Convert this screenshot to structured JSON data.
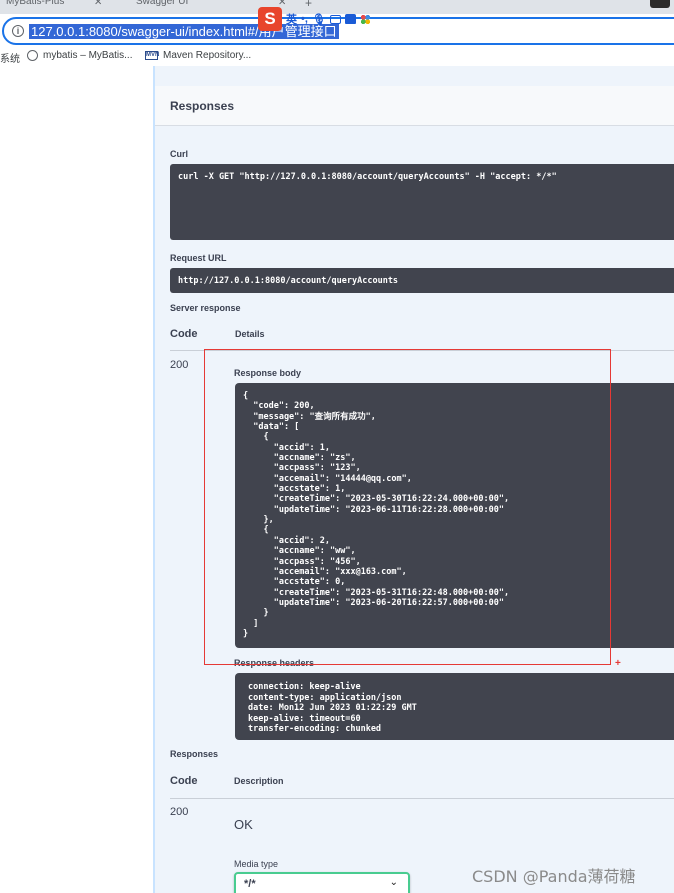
{
  "browser": {
    "tabs": [
      {
        "title": "MyBatis-Plus"
      },
      {
        "title": "Swagger UI"
      }
    ],
    "url": "127.0.0.1:8080/swagger-ui/index.html#/用户管理接口",
    "ime": {
      "label": "英"
    },
    "bookmarks": [
      {
        "label": "系统"
      },
      {
        "label": "mybatis – MyBatis..."
      },
      {
        "label": "Maven Repository..."
      }
    ]
  },
  "responses_section": {
    "title": "Responses",
    "curl_label": "Curl",
    "curl_command": "curl -X GET \"http://127.0.0.1:8080/account/queryAccounts\" -H \"accept: */*\"",
    "request_url_label": "Request URL",
    "request_url": "http://127.0.0.1:8080/account/queryAccounts",
    "server_response_label": "Server response",
    "code_header": "Code",
    "details_header": "Details",
    "status_code": "200",
    "response_body_label": "Response body",
    "response_body": "{\n  \"code\": 200,\n  \"message\": \"查询所有成功\",\n  \"data\": [\n    {\n      \"accid\": 1,\n      \"accname\": \"zs\",\n      \"accpass\": \"123\",\n      \"accemail\": \"14444@qq.com\",\n      \"accstate\": 1,\n      \"createTime\": \"2023-05-30T16:22:24.000+00:00\",\n      \"updateTime\": \"2023-06-11T16:22:28.000+00:00\"\n    },\n    {\n      \"accid\": 2,\n      \"accname\": \"ww\",\n      \"accpass\": \"456\",\n      \"accemail\": \"xxx@163.com\",\n      \"accstate\": 0,\n      \"createTime\": \"2023-05-31T16:22:48.000+00:00\",\n      \"updateTime\": \"2023-06-20T16:22:57.000+00:00\"\n    }\n  ]\n}",
    "response_headers_label": "Response headers",
    "response_headers": "connection: keep-alive\ncontent-type: application/json\ndate: Mon12 Jun 2023 01:22:29 GMT\nkeep-alive: timeout=60\ntransfer-encoding: chunked"
  },
  "documented_responses": {
    "title": "Responses",
    "code_header": "Code",
    "description_header": "Description",
    "code": "200",
    "description": "OK",
    "media_type_label": "Media type",
    "media_type_value": "*/*"
  },
  "watermark": "CSDN @Panda薄荷糖"
}
